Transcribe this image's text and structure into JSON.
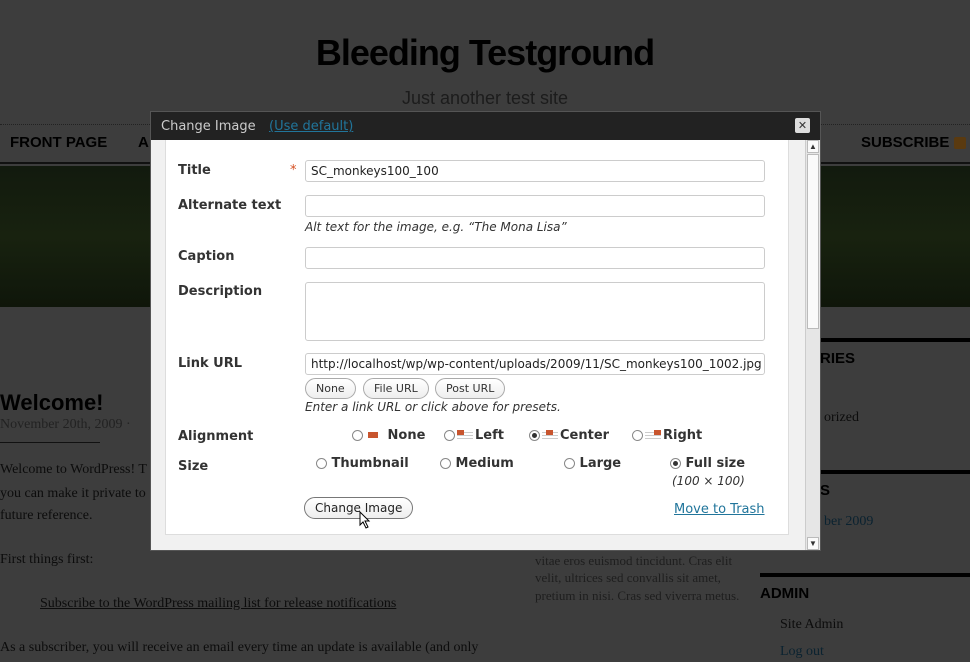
{
  "site": {
    "title": "Bleeding Testground",
    "tagline": "Just another test site",
    "nav": [
      "FRONT PAGE",
      "A"
    ],
    "subscribe": "SUBSCRIBE",
    "post": {
      "title": "Welcome!",
      "meta": "November 20th, 2009 ·",
      "lines": [
        "Welcome to WordPress! T",
        "you can make it private to",
        "future reference.",
        "First things first:"
      ],
      "link": "Subscribe to the WordPress mailing list for release notifications",
      "last": "As a subscriber, you will receive an email every time an update is available (and only"
    },
    "middle": [
      "vitae eros euismod tincidunt. Cras elit",
      "velit, ultrices sed convallis sit amet,",
      "pretium in nisi. Cras sed viverra metus."
    ],
    "sidebar": {
      "cat_heading": "RIES",
      "cat_item": "orized",
      "arch_heading": "S",
      "arch_item": "ber 2009",
      "admin_heading": "ADMIN",
      "admin_items": [
        "Site Admin",
        "Log out"
      ]
    }
  },
  "dialog": {
    "title": "Change Image",
    "use_default": "(Use default)",
    "fields": {
      "title_label": "Title",
      "title_value": "SC_monkeys100_100",
      "required": "*",
      "alt_label": "Alternate text",
      "alt_value": "",
      "alt_hint": "Alt text for the image, e.g. “The Mona Lisa”",
      "caption_label": "Caption",
      "caption_value": "",
      "description_label": "Description",
      "description_value": "",
      "link_label": "Link URL",
      "link_value": "http://localhost/wp/wp-content/uploads/2009/11/SC_monkeys100_1002.jpg",
      "link_buttons": [
        "None",
        "File URL",
        "Post URL"
      ],
      "link_hint": "Enter a link URL or click above for presets.",
      "alignment_label": "Alignment",
      "alignment_options": [
        "None",
        "Left",
        "Center",
        "Right"
      ],
      "alignment_selected": "Center",
      "size_label": "Size",
      "size_options": [
        "Thumbnail",
        "Medium",
        "Large",
        "Full size"
      ],
      "size_selected": "Full size",
      "full_size_dims": "(100 × 100)"
    },
    "change_image": "Change Image",
    "move_to_trash": "Move to Trash"
  },
  "colors": {
    "accent_link": "#21759b",
    "required": "#d54e21",
    "align_icon": "#c8552e"
  }
}
